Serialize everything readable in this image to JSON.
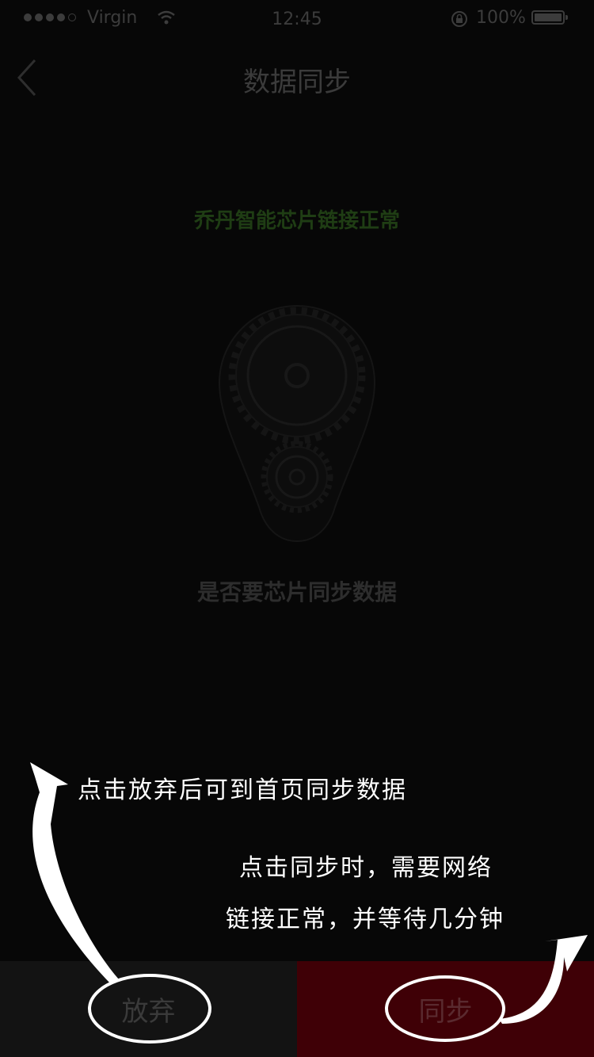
{
  "status_bar": {
    "carrier": "Virgin",
    "time": "12:45",
    "battery_percent": "100%",
    "signal_bars_filled": 4,
    "signal_bars_total": 5
  },
  "nav": {
    "title": "数据同步"
  },
  "main": {
    "chip_status": "乔丹智能芯片链接正常",
    "question": "是否要芯片同步数据"
  },
  "annotations": {
    "discard_hint": "点击放弃后可到首页同步数据",
    "sync_hint_line1": "点击同步时，需要网络",
    "sync_hint_line2": "链接正常，并等待几分钟"
  },
  "buttons": {
    "discard_label": "放弃",
    "sync_label": "同步"
  },
  "colors": {
    "background": "#070707",
    "chip_status": "#1f3d14",
    "sync_button": "#3f0006",
    "discard_button": "#131313",
    "annotation": "#ffffff"
  },
  "icons": [
    "back-chevron-icon",
    "wifi-icon",
    "lock-rotation-icon",
    "battery-icon",
    "gears-icon"
  ]
}
